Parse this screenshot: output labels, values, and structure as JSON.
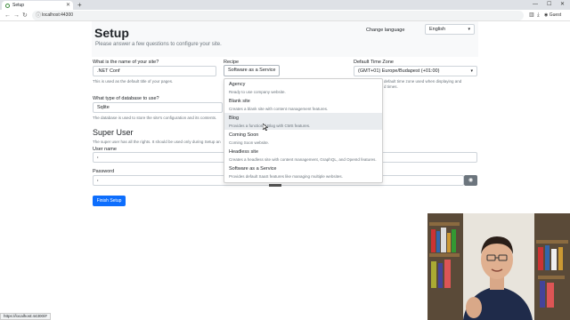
{
  "browser": {
    "tab_title": "Setup",
    "url": "localhost:44300",
    "profile_label": "Guest",
    "status_url": "https://localhost:44300/#"
  },
  "header": {
    "title": "Setup",
    "subtitle": "Please answer a few questions to configure your site.",
    "language_label": "Change language",
    "language_value": "English"
  },
  "form": {
    "site_name_label": "What is the name of your site?",
    "site_name_value": ".NET Conf",
    "site_name_help": "This is used as the default title of your pages.",
    "recipe_label": "Recipe",
    "recipe_value": "Software as a Service",
    "timezone_label": "Default Time Zone",
    "timezone_value": "(GMT+01) Europe/Budapest (+01:00)",
    "timezone_help": "default time zone used when displaying and",
    "timezone_help2": "d times.",
    "db_label": "What type of database to use?",
    "db_value": "Sqlite",
    "db_help": "The database is used to store the site's configuration and its contents.",
    "superuser_title": "Super User",
    "superuser_help": "The super user has all the rights. It should be used only during Setup an",
    "username_label": "User name",
    "username_value": "•",
    "password_label": "Password",
    "password_value": "•",
    "finish_label": "Finish Setup"
  },
  "recipes": [
    {
      "name": "Agency",
      "description": "Ready to use company website."
    },
    {
      "name": "Blank site",
      "description": "Creates a blank site with content management features."
    },
    {
      "name": "Blog",
      "description": "Provides a functional Blog with CMS features."
    },
    {
      "name": "Coming Soon",
      "description": "Coming Soon website."
    },
    {
      "name": "Headless site",
      "description": "Creates a headless site with content management, GraphQL, and OpenId features."
    },
    {
      "name": "Software as a Service",
      "description": "Provides default SaaS features like managing multiple websites."
    }
  ],
  "highlighted_recipe": "Blog",
  "colors": {
    "primary": "#0d6efd",
    "secondary": "#6c757d"
  }
}
